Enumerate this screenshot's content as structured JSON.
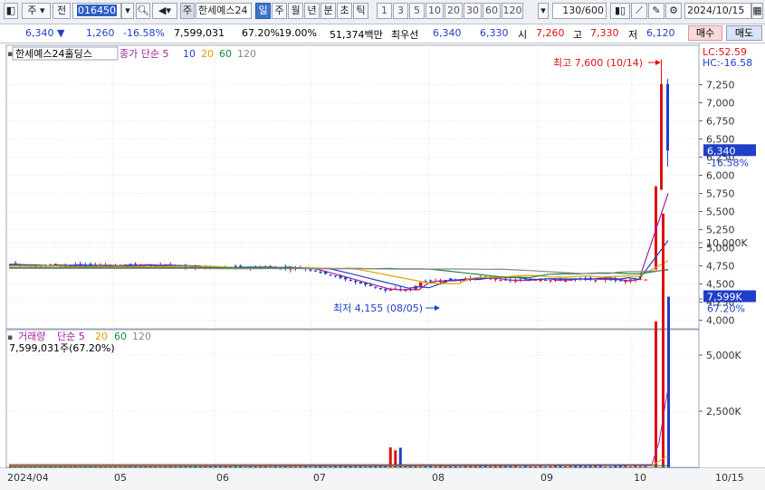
{
  "toolbar": {
    "market": "주",
    "prev_label": "전",
    "code": "016450",
    "stock_type": "주",
    "stock_name": "한세예스24",
    "periods": [
      "일",
      "주",
      "월",
      "년",
      "분",
      "초",
      "틱"
    ],
    "selected_period": "일",
    "intervals": [
      "1",
      "3",
      "5",
      "10",
      "20",
      "30",
      "60",
      "120"
    ],
    "count": "130",
    "count_total": "/600",
    "date": "2024/10/15"
  },
  "quote": {
    "price": "6,340",
    "change_arrow": "▼",
    "change": "1,260",
    "change_pct": "-16.58%",
    "volume": "7,599,031",
    "turnover_pct": "67.20%",
    "foreign_pct": "19.00%",
    "amount": "51,374백만",
    "best_bid_label": "최우선",
    "best_bid": "6,340",
    "best_ask": "6,330",
    "open_label": "시",
    "open": "7,260",
    "high_label": "고",
    "high": "7,330",
    "low_label": "저",
    "low": "6,120",
    "buy_label": "매수",
    "sell_label": "매도"
  },
  "price_panel": {
    "stock_label": "한세예스24홀딩스",
    "indicator_label": "종가 단순",
    "ma_periods": [
      "5",
      "10",
      "20",
      "60",
      "120"
    ],
    "lc": "LC:52.59",
    "hc": "HC:-16.58",
    "high_annotation": "최고 7,600 (10/14)",
    "low_annotation": "최저 4,155 (08/05)",
    "current_price": "6,340",
    "current_change": "-16.58%"
  },
  "volume_panel": {
    "label": "거래량",
    "indicator_label": "단순",
    "ma_periods": [
      "5",
      "20",
      "60",
      "120"
    ],
    "current_volume_text": "7,599,031주(67.20%)",
    "current_volume_tag": "7,599K",
    "current_volume_pct": "67.20%"
  },
  "colors": {
    "up": "#e01010",
    "down": "#1f3fc8",
    "ma5": "#a020a0",
    "ma10": "#1f3fc8",
    "ma20": "#e0a000",
    "ma60": "#1a8a3a",
    "ma120": "#888888"
  },
  "chart_data": {
    "type": "candlestick",
    "price_axis": {
      "ticks": [
        "7,250",
        "7,000",
        "6,750",
        "6,500",
        "6,250",
        "6,000",
        "5,750",
        "5,500",
        "5,250",
        "5,000",
        "4,750",
        "4,500",
        "4,250",
        "4,000"
      ],
      "ylim": [
        4000,
        7700
      ]
    },
    "volume_axis": {
      "ticks": [
        "10,000K",
        "7,500K",
        "5,000K",
        "2,500K"
      ],
      "ylim": [
        0,
        12000
      ]
    },
    "x_labels": [
      "2024/04",
      "05",
      "06",
      "07",
      "08",
      "09",
      "10",
      "10/15"
    ],
    "recent_candles": [
      {
        "date": "10/14",
        "open": 5800,
        "high": 7600,
        "low": 5800,
        "close": 7260
      },
      {
        "date": "10/15",
        "open": 7260,
        "high": 7330,
        "low": 6120,
        "close": 6340
      }
    ],
    "recent_volume_k": [
      {
        "date": "10/11",
        "value": 6500
      },
      {
        "date": "10/14",
        "value": 11300
      },
      {
        "date": "10/15",
        "value": 7599
      }
    ]
  }
}
